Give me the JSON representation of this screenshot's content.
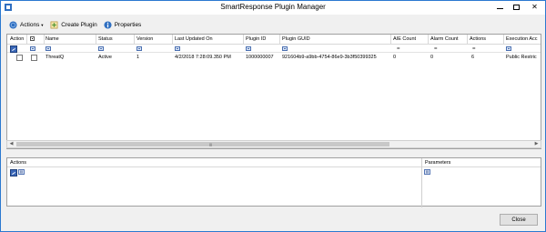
{
  "window": {
    "title": "SmartResponse Plugin Manager",
    "minimize_glyph": "",
    "close_glyph": "✕"
  },
  "toolbar": {
    "actions_label": "Actions",
    "actions_arrow": "▼",
    "create_plugin_label": "Create Plugin",
    "properties_label": "Properties"
  },
  "grid": {
    "columns": [
      "Action",
      "",
      "Name",
      "Status",
      "Version",
      "Last Updated On",
      "Plugin ID",
      "Plugin GUID",
      "AIE Count",
      "Alarm Count",
      "Actions",
      "Execution Acc"
    ],
    "filter_eq": "=",
    "row": {
      "name": "ThreatQ",
      "status": "Active",
      "version": "1",
      "last_updated": "4/2/2018 7:28:09.350 PM",
      "plugin_id": "1000000007",
      "plugin_guid": "921604b9-a9bb-4754-86e9-3b3f50399325",
      "aie_count": "0",
      "alarm_count": "0",
      "actions": "6",
      "execution_access": "Public Restric"
    }
  },
  "scrollbar": {
    "left_arrow": "◀",
    "right_arrow": "▶",
    "grip": "|||"
  },
  "bottom_panel": {
    "actions_header": "Actions",
    "parameters_header": "Parameters",
    "action_filter_icon": "▤",
    "param_filter_icon": "▤"
  },
  "footer": {
    "close_label": "Close"
  },
  "colors": {
    "accent": "#2b79d0",
    "toolbar_icon_blue": "#2f6fc1",
    "create_icon_green": "#5a9a3a"
  }
}
